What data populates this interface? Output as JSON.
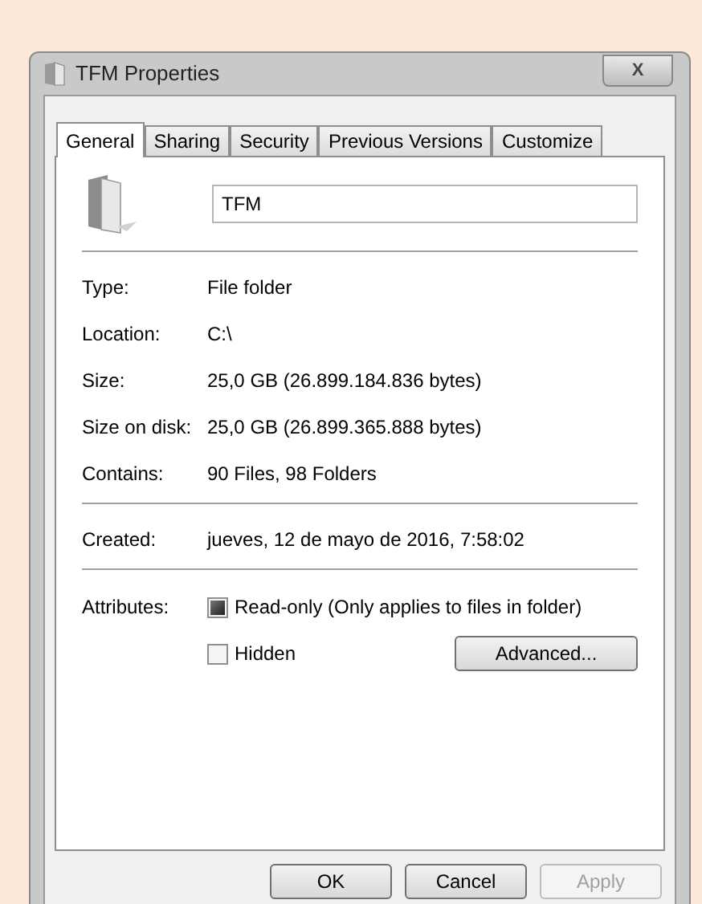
{
  "window": {
    "title": "TFM Properties",
    "close": "X"
  },
  "tabs": [
    {
      "label": "General",
      "selected": true
    },
    {
      "label": "Sharing",
      "selected": false
    },
    {
      "label": "Security",
      "selected": false
    },
    {
      "label": "Previous Versions",
      "selected": false
    },
    {
      "label": "Customize",
      "selected": false
    }
  ],
  "name_field": {
    "value": "TFM"
  },
  "groups": [
    [
      {
        "label": "Type:",
        "value": "File folder"
      },
      {
        "label": "Location:",
        "value": "C:\\"
      },
      {
        "label": "Size:",
        "value": "25,0 GB (26.899.184.836 bytes)"
      },
      {
        "label": "Size on disk:",
        "value": "25,0 GB (26.899.365.888 bytes)"
      },
      {
        "label": "Contains:",
        "value": "90 Files, 98 Folders"
      }
    ],
    [
      {
        "label": "Created:",
        "value": "jueves, 12 de mayo de 2016, 7:58:02"
      }
    ]
  ],
  "attributes": {
    "label": "Attributes:",
    "options": [
      {
        "label": "Read-only (Only applies to files in folder)",
        "checked": false,
        "indeterminate": true
      },
      {
        "label": "Hidden",
        "checked": false,
        "indeterminate": false
      }
    ],
    "advanced_button": "Advanced..."
  },
  "buttons": [
    {
      "label": "OK",
      "disabled": false
    },
    {
      "label": "Cancel",
      "disabled": false
    },
    {
      "label": "Apply",
      "disabled": true
    }
  ]
}
